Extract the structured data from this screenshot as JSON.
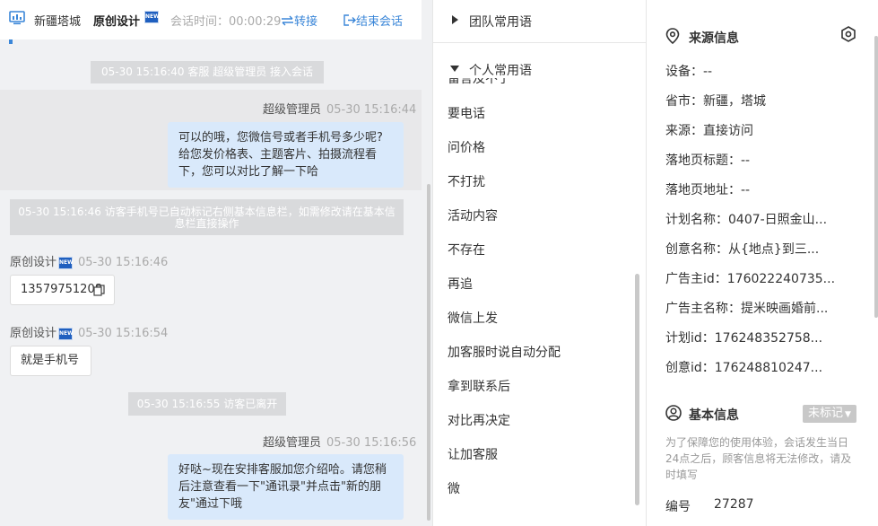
{
  "header": {
    "location": "新疆塔城",
    "shop_name": "原创设计",
    "new_badge": "NEW",
    "session_time": "会话时间：00:00:29",
    "transfer_label": "转接",
    "end_label": "结束会话"
  },
  "chat": {
    "sys_join": "05-30 15:16:40 客服 超级管理员 接入会话",
    "msg1_sender": "超级管理员",
    "msg1_time": "05-30 15:16:44",
    "msg1_lines": [
      "可以的哦，您微信号或者手机号多少呢?",
      "给您发价格表、主题客片、拍摄流程看",
      "下，您可以对比了解一下哈"
    ],
    "sys_phone": "05-30 15:16:46 访客手机号已自动标记右侧基本信息栏，如需修改请在基本信息栏直接操作",
    "msg2_sender": "原创设计",
    "msg2_time": "05-30 15:16:46",
    "msg2_text": "13579751208",
    "msg3_sender": "原创设计",
    "msg3_time": "05-30 15:16:54",
    "msg3_text": "就是手机号",
    "sys_left": "05-30 15:16:55 访客已离开",
    "msg4_sender": "超级管理员",
    "msg4_time": "05-30 15:16:56",
    "msg4_lines": [
      "好哒~现在安排客服加您介绍哈。请您稍",
      "后注意查看一下\"通讯录\"并点击\"新的朋",
      "友\"通过下哦"
    ]
  },
  "phrases": {
    "team_group": "团队常用语",
    "personal_group": "个人常用语",
    "cut_item": "留言及不了",
    "items": [
      "要电话",
      "问价格",
      "不打扰",
      "活动内容",
      "不存在",
      "再追",
      "微信上发",
      "加客服时说自动分配",
      "拿到联系后",
      "对比再决定",
      "让加客服",
      "微"
    ]
  },
  "info": {
    "source_title": "来源信息",
    "rows": [
      "设备：--",
      "省市：新疆，塔城",
      "来源：直接访问",
      "落地页标题：--",
      "落地页地址：--",
      "计划名称：0407-日照金山...",
      "创意名称：从{地点}到三...",
      "广告主id：176022240735...",
      "广告主名称：提米映画婚前...",
      "计划id：176248352758...",
      "创意id：176248810247..."
    ],
    "basic_title": "基本信息",
    "tag_status": "未标记",
    "hint": "为了保障您的使用体验，会话发生当日24点之后，顾客信息将无法修改，请及时填写",
    "number_label": "编号",
    "number_value": "27287"
  }
}
